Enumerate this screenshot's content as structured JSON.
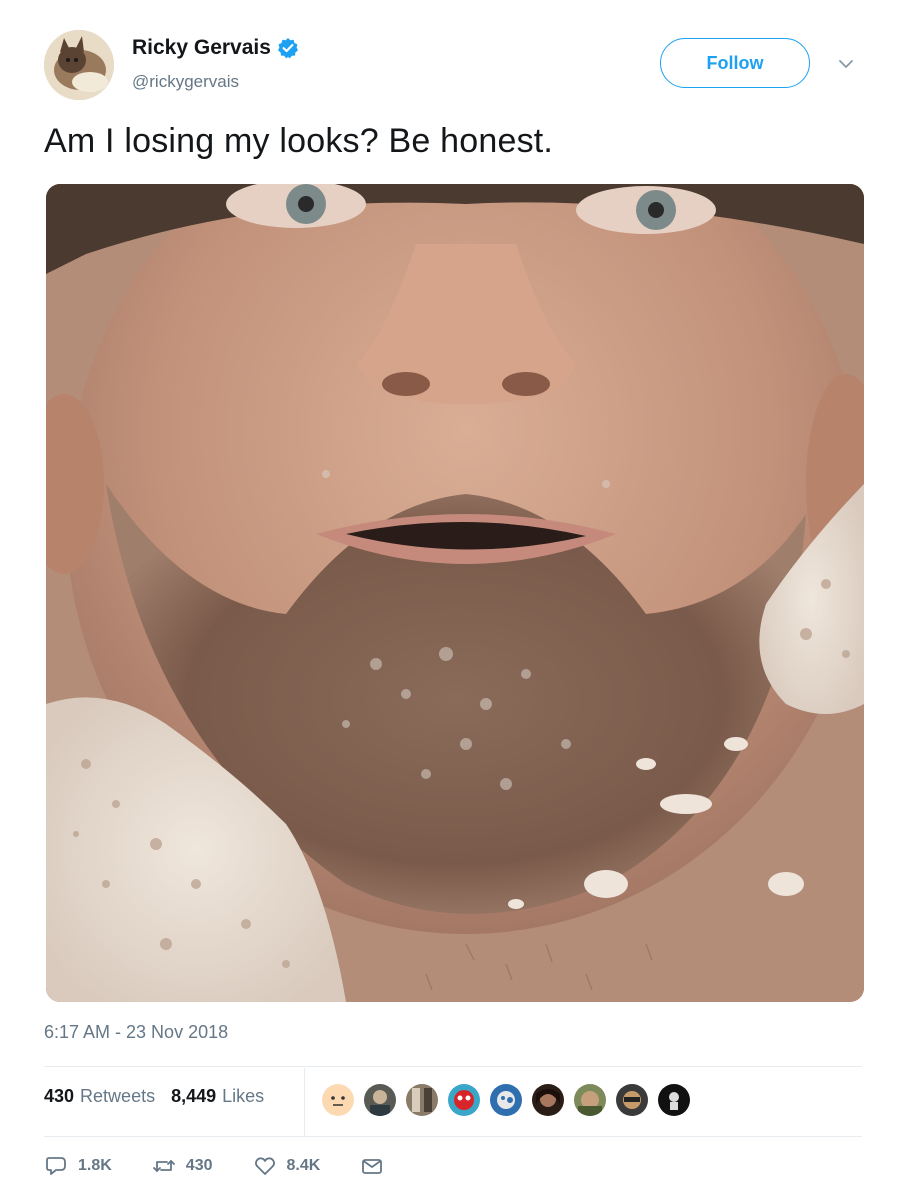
{
  "tweet": {
    "author_name": "Ricky Gervais",
    "author_handle": "@rickygervais",
    "follow_label": "Follow",
    "text": "Am I losing my looks? Be honest.",
    "timestamp": "6:17 AM - 23 Nov 2018"
  },
  "stats": {
    "retweets_count": "430",
    "retweets_label": "Retweets",
    "likes_count": "8,449",
    "likes_label": "Likes"
  },
  "actions": {
    "reply_count": "1.8K",
    "retweet_count": "430",
    "like_count": "8.4K"
  },
  "colors": {
    "accent": "#1da1f2",
    "muted": "#657786",
    "divider": "#e6ecf0"
  },
  "icons": [
    "verified-badge-icon",
    "chevron-down-icon",
    "reply-icon",
    "retweet-icon",
    "like-icon",
    "dm-icon"
  ]
}
